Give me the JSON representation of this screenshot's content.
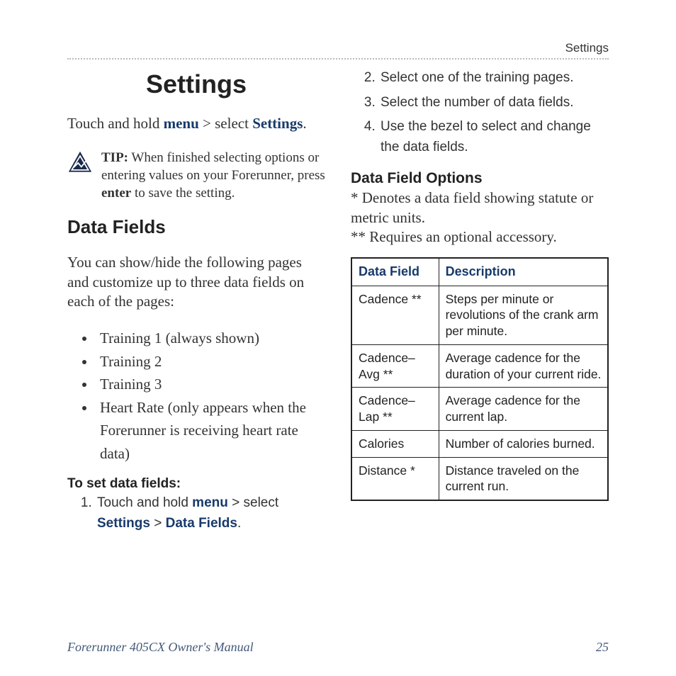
{
  "running_head": "Settings",
  "title": "Settings",
  "intro": {
    "prefix": "Touch and hold ",
    "menu": "menu",
    "mid": " > select ",
    "settings": "Settings",
    "suffix": "."
  },
  "tip": {
    "label": "TIP:",
    "before": " When finished selecting options or entering values on your Forerunner, press ",
    "enter": "enter",
    "after": " to save the setting."
  },
  "datafields": {
    "heading": "Data Fields",
    "intro": "You can show/hide the following pages and customize up to three data fields on each of the pages:",
    "bullets": [
      "Training 1 (always shown)",
      "Training 2",
      "Training 3",
      "Heart Rate (only appears when the Forerunner is receiving heart rate data)"
    ],
    "tosethdr": "To set data fields:",
    "step1": {
      "prefix": "Touch and hold ",
      "menu": "menu",
      "mid1": " > select ",
      "settings": "Settings",
      "mid2": " > ",
      "datafields": "Data Fields",
      "suffix": "."
    }
  },
  "steps_right": [
    "Select one of the training pages.",
    "Select the number of data fields.",
    "Use the bezel to select and change the data fields."
  ],
  "options": {
    "heading": "Data Field Options",
    "note1": "* Denotes a data field showing statute or metric units.",
    "note2": "** Requires an optional accessory."
  },
  "table": {
    "h1": "Data Field",
    "h2": "Description",
    "rows": [
      {
        "f": "Cadence **",
        "d": "Steps per minute or revolutions of the crank arm per minute."
      },
      {
        "f": "Cadence–Avg **",
        "d": "Average cadence for the duration of your current ride."
      },
      {
        "f": "Cadence–Lap **",
        "d": "Average cadence for the current lap."
      },
      {
        "f": "Calories",
        "d": "Number of calories burned."
      },
      {
        "f": "Distance *",
        "d": "Distance traveled on the current run."
      }
    ]
  },
  "footer": {
    "title": "Forerunner 405CX Owner's Manual",
    "page": "25"
  }
}
